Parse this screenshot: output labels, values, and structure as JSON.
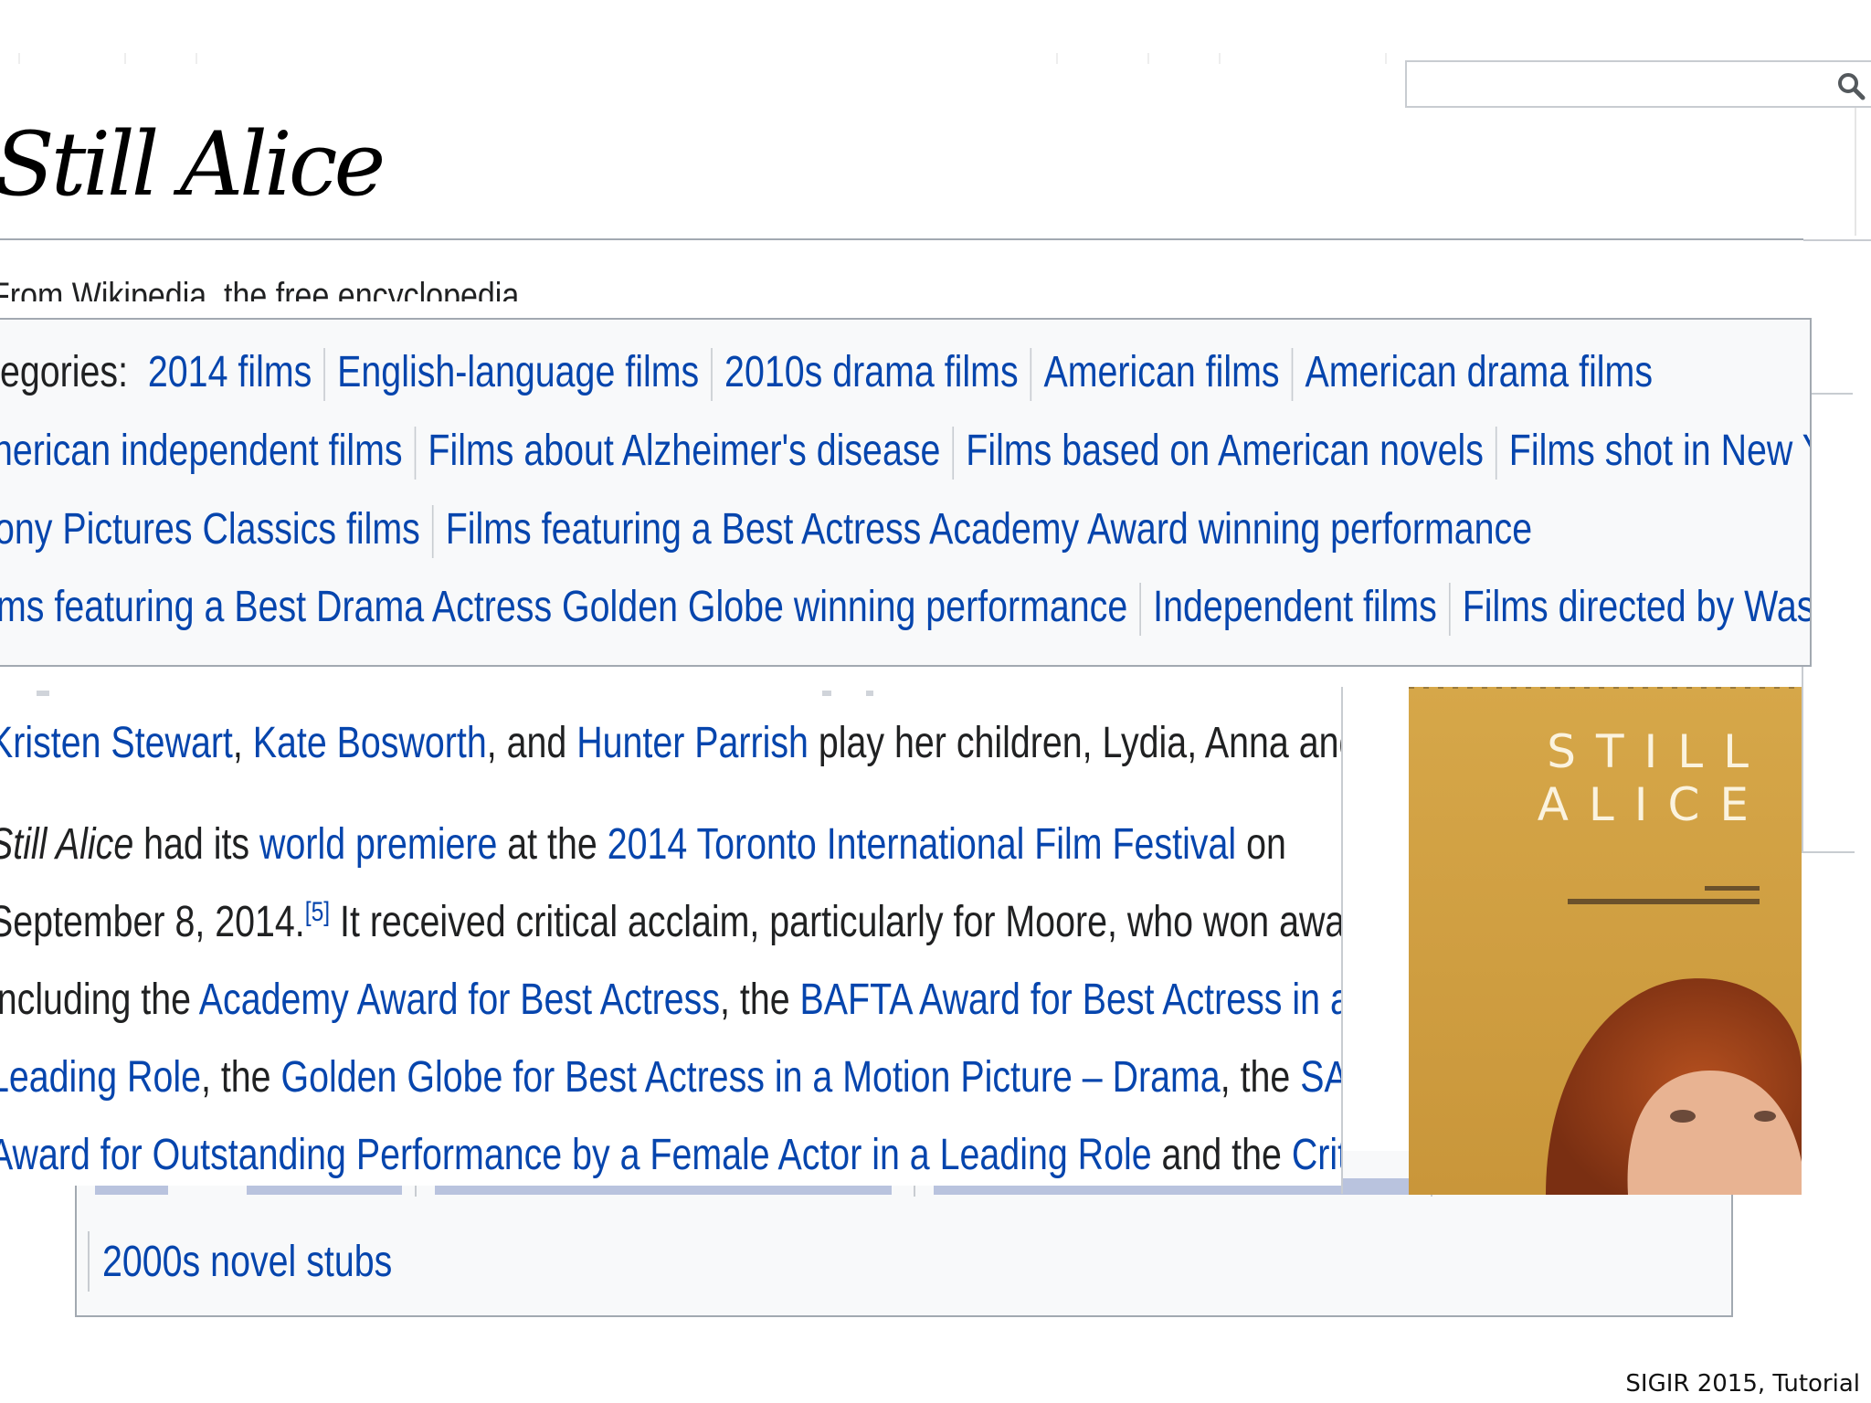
{
  "page": {
    "title": "Still Alice",
    "tagline": "From Wikipedia, the free encyclopedia"
  },
  "categories": {
    "row1": {
      "label": "egories:",
      "items": [
        "2014 films",
        "English-language films",
        "2010s drama films",
        "American films",
        "American drama films"
      ]
    },
    "row2": {
      "items": [
        "nerican independent films",
        "Films about Alzheimer's disease",
        "Films based on American novels",
        "Films shot in New York"
      ]
    },
    "row3": {
      "items": [
        "ony Pictures Classics films",
        "Films featuring a Best Actress Academy Award winning performance"
      ]
    },
    "row4": {
      "items": [
        "ms featuring a Best Drama Actress Golden Globe winning performance",
        "Independent films",
        "Films directed by Wash West"
      ]
    }
  },
  "article": {
    "line1": {
      "l1": "Kristen Stewart",
      "t1": ", ",
      "l2": "Kate Bosworth",
      "t2": ", and ",
      "l3": "Hunter Parrish",
      "t3": " play her children, Lydia, Anna and Tom."
    },
    "line2": {
      "italic": "Still Alice",
      "t1": " had its ",
      "l1": "world premiere",
      "t2": " at the ",
      "l2": "2014 Toronto International Film Festival",
      "t3": " on"
    },
    "line3": {
      "t1": "September 8, 2014.",
      "sup": "[5]",
      "t2": " It received critical acclaim, particularly for Moore, who won awards"
    },
    "line4": {
      "t1": "including the ",
      "l1": "Academy Award for Best Actress",
      "t2": ", the ",
      "l2": "BAFTA Award for Best Actress in a"
    },
    "line5": {
      "l1": "Leading Role",
      "t1": ", the ",
      "l2": "Golden Globe for Best Actress in a Motion Picture – Drama",
      "t2": ", the ",
      "l3": "SAG"
    },
    "line6": {
      "l1": "Award for Outstanding Performance by a Female Actor in a Leading Role",
      "t1": " and the ",
      "l2": "Critics'"
    }
  },
  "poster": {
    "title_line1": "STILL",
    "title_line2": "ALICE",
    "colors": {
      "background": "#d3a444",
      "title": "#fbf3df"
    }
  },
  "back_categories": {
    "item": "2000s novel stubs"
  },
  "footer": {
    "note": "SIGIR 2015, Tutorial"
  },
  "colors": {
    "link": "#0645ad",
    "text": "#202122",
    "border": "#a2a9b1",
    "box_bg": "#f8f9fa"
  }
}
